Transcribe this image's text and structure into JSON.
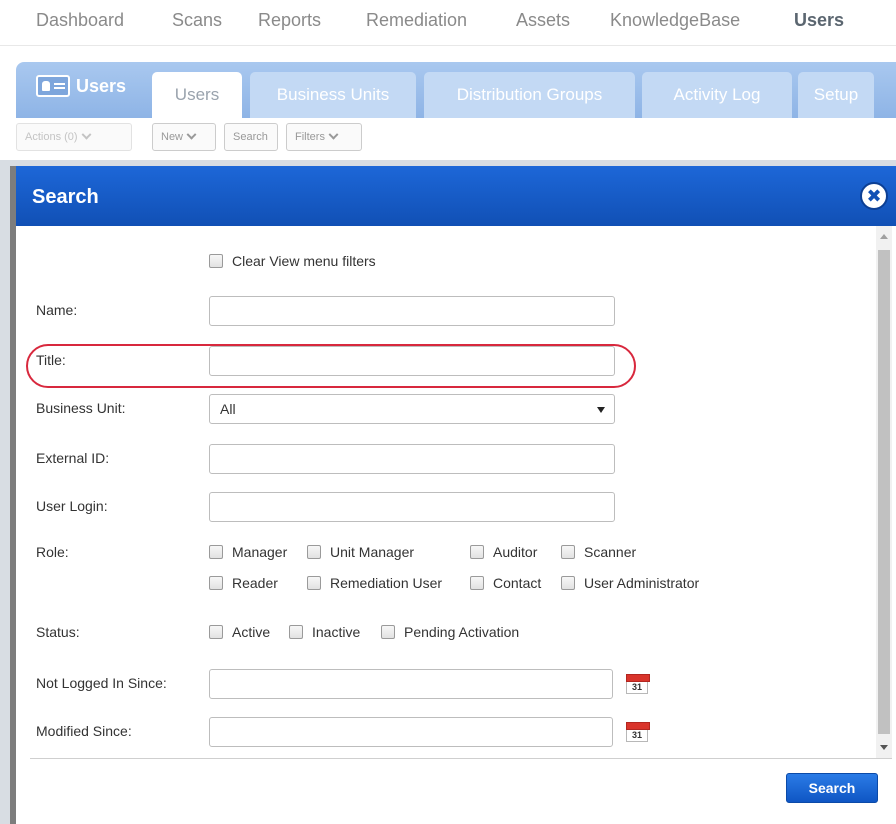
{
  "top_nav": {
    "items": [
      "Dashboard",
      "Scans",
      "Reports",
      "Remediation",
      "Assets",
      "KnowledgeBase",
      "Users"
    ],
    "active": "Users"
  },
  "module": {
    "title": "Users",
    "icon": "users-card-icon",
    "tabs": [
      {
        "label": "Users",
        "active": true
      },
      {
        "label": "Business Units",
        "active": false
      },
      {
        "label": "Distribution Groups",
        "active": false
      },
      {
        "label": "Activity Log",
        "active": false
      },
      {
        "label": "Setup",
        "active": false
      }
    ]
  },
  "toolbar": {
    "actions_label": "Actions (0)",
    "new_label": "New",
    "search_label": "Search",
    "filters_label": "Filters"
  },
  "modal": {
    "title": "Search",
    "close_icon": "close-icon",
    "clear_filters_label": "Clear View menu filters",
    "fields": {
      "name": {
        "label": "Name:",
        "value": ""
      },
      "title": {
        "label": "Title:",
        "value": ""
      },
      "business_unit": {
        "label": "Business Unit:",
        "value": "All"
      },
      "external_id": {
        "label": "External ID:",
        "value": ""
      },
      "user_login": {
        "label": "User Login:",
        "value": ""
      },
      "not_logged_in_since": {
        "label": "Not Logged In Since:",
        "value": "",
        "calendar_day": "31"
      },
      "modified_since": {
        "label": "Modified Since:",
        "value": "",
        "calendar_day": "31"
      }
    },
    "role": {
      "label": "Role:",
      "options": [
        "Manager",
        "Unit Manager",
        "Auditor",
        "Scanner",
        "Reader",
        "Remediation User",
        "Contact",
        "User Administrator"
      ]
    },
    "status": {
      "label": "Status:",
      "options": [
        "Active",
        "Inactive",
        "Pending Activation"
      ]
    },
    "search_button": "Search"
  },
  "colors": {
    "modal_header": "#1150b5",
    "tab_bar": "#8eb4e6",
    "highlight_ring": "#d8283d",
    "primary_button": "#0f56c4"
  }
}
